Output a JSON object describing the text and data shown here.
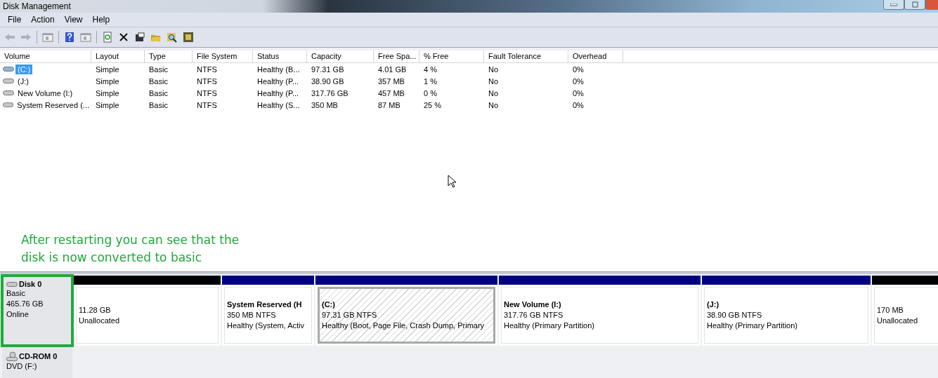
{
  "window": {
    "title": "Disk Management"
  },
  "menu": [
    "File",
    "Action",
    "View",
    "Help"
  ],
  "toolbar": [
    {
      "disabled": true
    },
    {
      "disabled": true
    },
    {
      "disabled": false
    },
    {
      "disabled": false
    },
    {
      "disabled": false
    },
    {
      "disabled": false
    },
    {
      "disabled": false
    },
    {
      "disabled": false
    },
    {
      "disabled": false
    },
    {
      "disabled": false
    },
    {
      "disabled": false
    }
  ],
  "table": {
    "columns": [
      "Volume",
      "Layout",
      "Type",
      "File System",
      "Status",
      "Capacity",
      "Free Spa...",
      "% Free",
      "Fault Tolerance",
      "Overhead"
    ],
    "rows": [
      {
        "selected": true,
        "cells": [
          "(C:)",
          "Simple",
          "Basic",
          "NTFS",
          "Healthy (B...",
          "97.31 GB",
          "4.01 GB",
          "4 %",
          "No",
          "0%"
        ]
      },
      {
        "selected": false,
        "cells": [
          "(J:)",
          "Simple",
          "Basic",
          "NTFS",
          "Healthy (P...",
          "38.90 GB",
          "357 MB",
          "1 %",
          "No",
          "0%"
        ]
      },
      {
        "selected": false,
        "cells": [
          "New Volume (I:)",
          "Simple",
          "Basic",
          "NTFS",
          "Healthy (P...",
          "317.76 GB",
          "457 MB",
          "0 %",
          "No",
          "0%"
        ]
      },
      {
        "selected": false,
        "cells": [
          "System Reserved (...",
          "Simple",
          "Basic",
          "NTFS",
          "Healthy (S...",
          "350 MB",
          "87 MB",
          "25 %",
          "No",
          "0%"
        ]
      }
    ]
  },
  "annotation": {
    "lines": [
      "After restarting you can see that the",
      "disk is now converted to basic"
    ]
  },
  "disks": [
    {
      "kind": "disk",
      "name": "Disk 0",
      "details": [
        "Basic",
        "465.76 GB",
        "Online"
      ],
      "highlighted": true,
      "partitions": [
        {
          "kind": "unallocated",
          "selected": false,
          "size": "11.28 GB",
          "status": "Unallocated"
        },
        {
          "kind": "primary",
          "selected": false,
          "name": "System Reserved  (H",
          "size": "350 MB NTFS",
          "status": "Healthy (System, Activ"
        },
        {
          "kind": "primary",
          "selected": true,
          "name": "(C:)",
          "size": "97.31 GB NTFS",
          "status": "Healthy (Boot, Page File, Crash Dump, Primary"
        },
        {
          "kind": "primary",
          "selected": false,
          "name": "New Volume  (I:)",
          "size": "317.76 GB NTFS",
          "status": "Healthy (Primary Partition)"
        },
        {
          "kind": "primary",
          "selected": false,
          "name": "(J:)",
          "size": "38.90 GB NTFS",
          "status": "Healthy (Primary Partition)"
        },
        {
          "kind": "unallocated",
          "selected": false,
          "size": "170 MB",
          "status": "Unallocated"
        }
      ]
    },
    {
      "kind": "cdrom",
      "name": "CD-ROM 0",
      "details": [
        "DVD (F:)"
      ],
      "highlighted": false
    }
  ]
}
